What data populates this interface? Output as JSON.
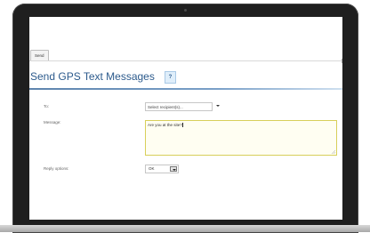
{
  "toolbar": {
    "send_label": "Send"
  },
  "page": {
    "title": "Send GPS Text Messages",
    "help_label": "?"
  },
  "form": {
    "to_label": "To:",
    "to_placeholder": "Select recipient(s)...",
    "message_label": "Message:",
    "message_value": "Are you at the site?",
    "reply_label": "Reply options:",
    "reply_value": "OK"
  },
  "colors": {
    "title": "#2c5a8c",
    "title_rule": "#5e84ad",
    "textarea_border": "#d8cf5a",
    "textarea_bg": "#fffef2"
  }
}
